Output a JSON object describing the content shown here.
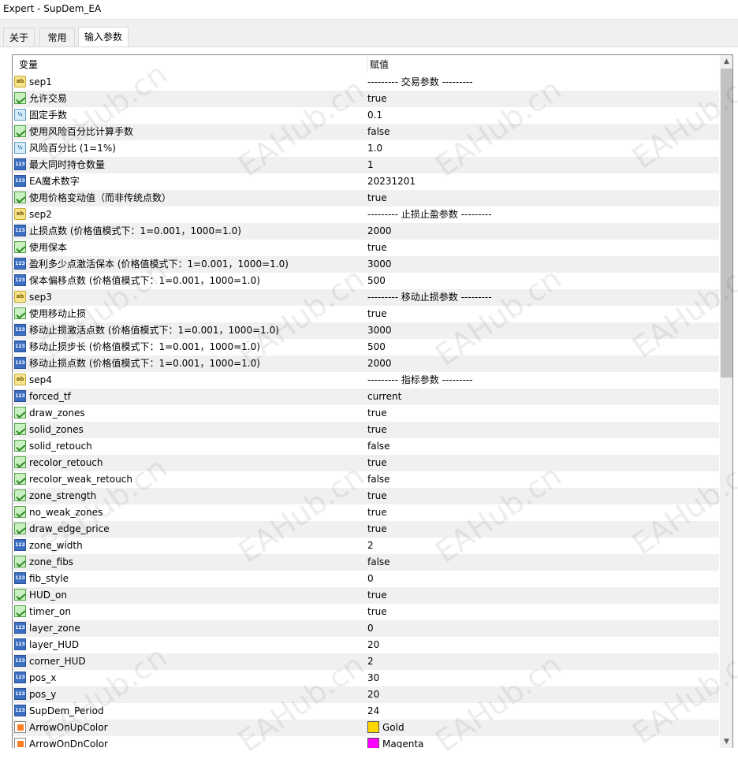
{
  "window": {
    "title": "Expert - SupDem_EA"
  },
  "tabs": [
    {
      "label": "关于",
      "active": false
    },
    {
      "label": "常用",
      "active": false
    },
    {
      "label": "输入参数",
      "active": true
    }
  ],
  "grid": {
    "headers": {
      "variable": "变量",
      "value": "赋值"
    },
    "rows": [
      {
        "icon": "ab",
        "name": "sep1",
        "value": "--------- 交易参数 ---------"
      },
      {
        "icon": "bool",
        "name": "允许交易",
        "value": "true"
      },
      {
        "icon": "frac",
        "name": "固定手数",
        "value": "0.1"
      },
      {
        "icon": "bool",
        "name": "使用风险百分比计算手数",
        "value": "false"
      },
      {
        "icon": "frac",
        "name": "风险百分比 (1=1%)",
        "value": "1.0"
      },
      {
        "icon": "int",
        "name": "最大同时持仓数量",
        "value": "1"
      },
      {
        "icon": "int",
        "name": "EA魔术数字",
        "value": "20231201"
      },
      {
        "icon": "bool",
        "name": "使用价格变动值（而非传统点数）",
        "value": "true"
      },
      {
        "icon": "ab",
        "name": "sep2",
        "value": "--------- 止损止盈参数 ---------"
      },
      {
        "icon": "int",
        "name": "止损点数 (价格值模式下：1=0.001，1000=1.0)",
        "value": "2000"
      },
      {
        "icon": "bool",
        "name": "使用保本",
        "value": "true"
      },
      {
        "icon": "int",
        "name": "盈利多少点激活保本 (价格值模式下：1=0.001，1000=1.0)",
        "value": "3000"
      },
      {
        "icon": "int",
        "name": "保本偏移点数 (价格值模式下：1=0.001，1000=1.0)",
        "value": "500"
      },
      {
        "icon": "ab",
        "name": "sep3",
        "value": "--------- 移动止损参数 ---------"
      },
      {
        "icon": "bool",
        "name": "使用移动止损",
        "value": "true"
      },
      {
        "icon": "int",
        "name": "移动止损激活点数 (价格值模式下：1=0.001，1000=1.0)",
        "value": "3000"
      },
      {
        "icon": "int",
        "name": "移动止损步长 (价格值模式下：1=0.001，1000=1.0)",
        "value": "500"
      },
      {
        "icon": "int",
        "name": "移动止损点数 (价格值模式下：1=0.001，1000=1.0)",
        "value": "2000"
      },
      {
        "icon": "ab",
        "name": "sep4",
        "value": "--------- 指标参数 ---------"
      },
      {
        "icon": "int",
        "name": "forced_tf",
        "value": "current"
      },
      {
        "icon": "bool",
        "name": "draw_zones",
        "value": "true"
      },
      {
        "icon": "bool",
        "name": "solid_zones",
        "value": "true"
      },
      {
        "icon": "bool",
        "name": "solid_retouch",
        "value": "false"
      },
      {
        "icon": "bool",
        "name": "recolor_retouch",
        "value": "true"
      },
      {
        "icon": "bool",
        "name": "recolor_weak_retouch",
        "value": "false"
      },
      {
        "icon": "bool",
        "name": "zone_strength",
        "value": "true"
      },
      {
        "icon": "bool",
        "name": "no_weak_zones",
        "value": "true"
      },
      {
        "icon": "bool",
        "name": "draw_edge_price",
        "value": "true"
      },
      {
        "icon": "int",
        "name": "zone_width",
        "value": "2"
      },
      {
        "icon": "bool",
        "name": "zone_fibs",
        "value": "false"
      },
      {
        "icon": "int",
        "name": "fib_style",
        "value": "0"
      },
      {
        "icon": "bool",
        "name": "HUD_on",
        "value": "true"
      },
      {
        "icon": "bool",
        "name": "timer_on",
        "value": "true"
      },
      {
        "icon": "int",
        "name": "layer_zone",
        "value": "0"
      },
      {
        "icon": "int",
        "name": "layer_HUD",
        "value": "20"
      },
      {
        "icon": "int",
        "name": "corner_HUD",
        "value": "2"
      },
      {
        "icon": "int",
        "name": "pos_x",
        "value": "30"
      },
      {
        "icon": "int",
        "name": "pos_y",
        "value": "20"
      },
      {
        "icon": "int",
        "name": "SupDem_Period",
        "value": "24"
      },
      {
        "icon": "color",
        "name": "ArrowOnUpColor",
        "value": "Gold",
        "swatch": "#ffd700"
      },
      {
        "icon": "color",
        "name": "ArrowOnDnColor",
        "value": "Magenta",
        "swatch": "#ff00ff"
      }
    ]
  },
  "icon_text": {
    "ab": "ab",
    "frac": "½",
    "int": "123"
  },
  "watermark": "EAHub.cn"
}
